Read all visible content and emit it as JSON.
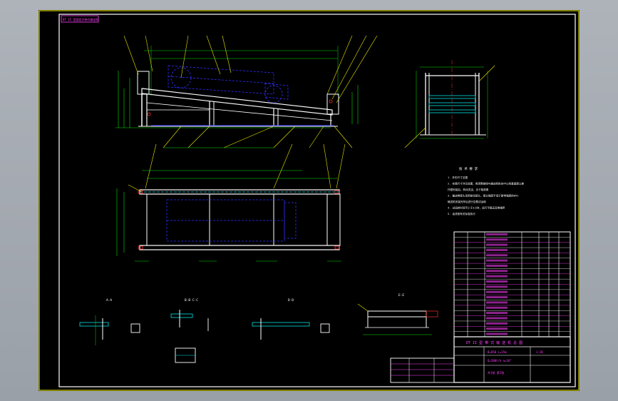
{
  "drawing": {
    "view_tag": "DT II 型固定式带式输送机",
    "section_labels": [
      "A-A",
      "B-B  C-C",
      "D-D",
      "E-E"
    ],
    "notes_title": "技 术 要 求",
    "notes": [
      "1. 外形尺寸见图",
      "2. 安装尺寸详见总图，各滚筒轴线与输送机纵向中心线垂直度公差",
      "   托辊安装后，转动灵活，无卡阻现象",
      "3. 输送带接头采用硫化接头，接头强度不低于原带强度的85%",
      "   输送机安装完毕后进行空载试运转",
      "4. 试运转时间不少于2小时，运行平稳无异常噪声",
      "5. 油漆按有关标准执行"
    ],
    "title_block": {
      "title": "DT II 型 带 式 输 送 机 总 图",
      "spec_line1": "B=650  L=15m",
      "spec_line2": "Q=200t/h  α=16°",
      "scale": "1:20",
      "sheet": "共1张 第1张"
    },
    "parts_columns": [
      "序号",
      "代号",
      "名称",
      "数量",
      "材料",
      "备注"
    ]
  },
  "colors": {
    "background": "#000000",
    "outline": "#ffffff",
    "dimension": "#00e000",
    "leader": "#e8e800",
    "hidden": "#3030ff",
    "table": "#ff40ff",
    "accent": "#00e0e0"
  }
}
